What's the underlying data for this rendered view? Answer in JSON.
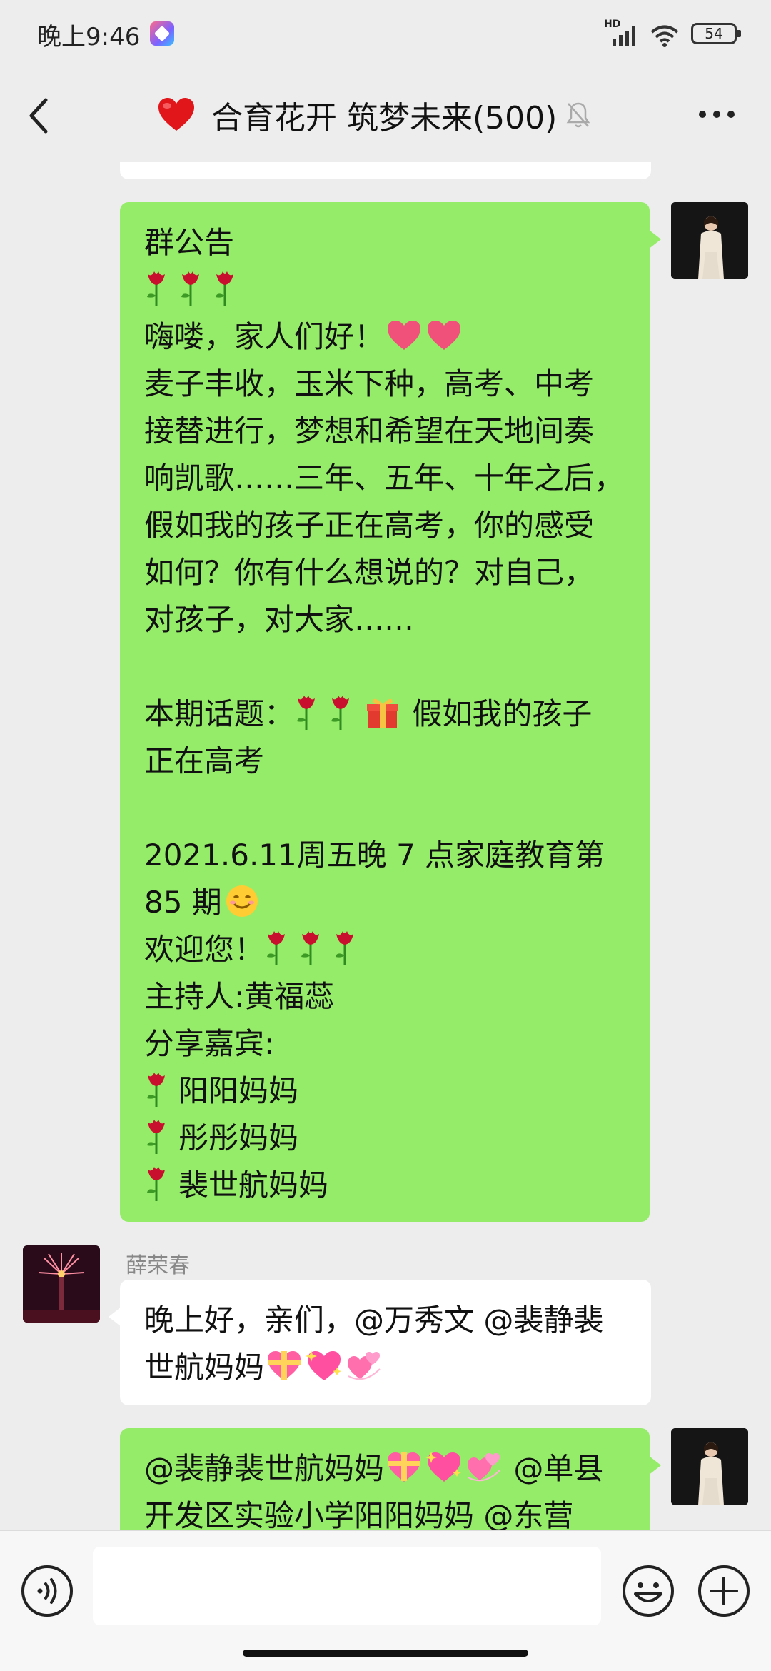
{
  "status_bar": {
    "time": "晚上9:46",
    "network": "HD",
    "battery": "54"
  },
  "header": {
    "title": "合育花开 筑梦未来(500)",
    "icons": [
      "back-icon",
      "heart-icon",
      "mute-icon",
      "more-icon"
    ]
  },
  "messages": {
    "announcement": {
      "lines": [
        "群公告",
        "",
        "嗨喽，家人们好！",
        "麦子丰收，玉米下种，高考、中考",
        "接替进行，梦想和希望在天地间奏",
        "响凯歌……三年、五年、十年之后，",
        "假如我的孩子正在高考，你的感受",
        "如何？你有什么想说的？对自己，",
        "对孩子，对大家……",
        "",
        "本期话题：",
        "假如我的孩子",
        "正在高考",
        "",
        "2021.6.11周五晚 7 点家庭教育第",
        "85 期",
        "欢迎您！",
        "主持人:黄福蕊",
        "分享嘉宾:",
        "阳阳妈妈",
        "彤彤妈妈",
        "裴世航妈妈"
      ]
    },
    "reply": {
      "sender": "薛荣春",
      "line1": "晚上好，亲们，@万秀文 @裴静裴",
      "line2": "世航妈妈"
    },
    "last": {
      "line1": "@裴静裴世航妈妈",
      "line1_tail": "@单县",
      "line2": "开发区实验小学阳阳妈妈 @东营"
    }
  },
  "input_bar": {
    "placeholder": "",
    "icons": [
      "voice-icon",
      "emoji-icon",
      "plus-icon"
    ]
  },
  "colors": {
    "background": "#ededed",
    "my_bubble": "#95ec69",
    "other_bubble": "#ffffff"
  }
}
